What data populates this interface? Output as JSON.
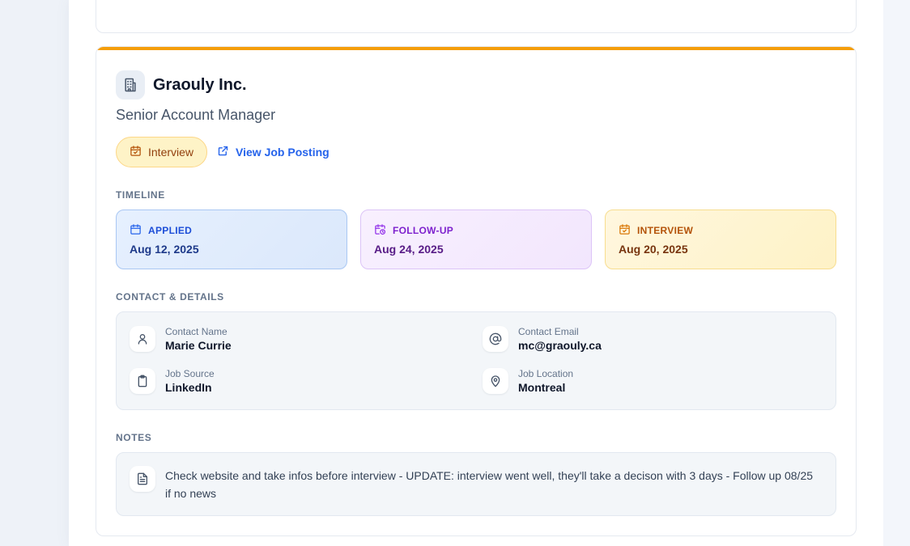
{
  "application": {
    "company": "Graouly Inc.",
    "job_title": "Senior Account Manager",
    "status": "Interview",
    "job_link_label": "View Job Posting",
    "accent_color": "#f59e0b"
  },
  "sections": {
    "timeline": "TIMELINE",
    "details": "CONTACT & DETAILS",
    "notes": "NOTES"
  },
  "timeline": [
    {
      "label": "APPLIED",
      "date": "Aug 12, 2025",
      "icon": "calendar-icon"
    },
    {
      "label": "FOLLOW-UP",
      "date": "Aug 24, 2025",
      "icon": "calendar-clock-icon"
    },
    {
      "label": "INTERVIEW",
      "date": "Aug 20, 2025",
      "icon": "calendar-check-icon"
    }
  ],
  "details": {
    "contact_name": {
      "label": "Contact Name",
      "value": "Marie Currie",
      "icon": "user-icon"
    },
    "contact_email": {
      "label": "Contact Email",
      "value": "mc@graouly.ca",
      "icon": "at-icon"
    },
    "job_source": {
      "label": "Job Source",
      "value": "LinkedIn",
      "icon": "clipboard-icon"
    },
    "job_location": {
      "label": "Job Location",
      "value": "Montreal",
      "icon": "map-pin-icon"
    }
  },
  "notes": {
    "text": "Check website and take infos before interview - UPDATE: interview went well, they'll take a decison with 3 days - Follow up 08/25 if no news",
    "icon": "file-text-icon"
  }
}
